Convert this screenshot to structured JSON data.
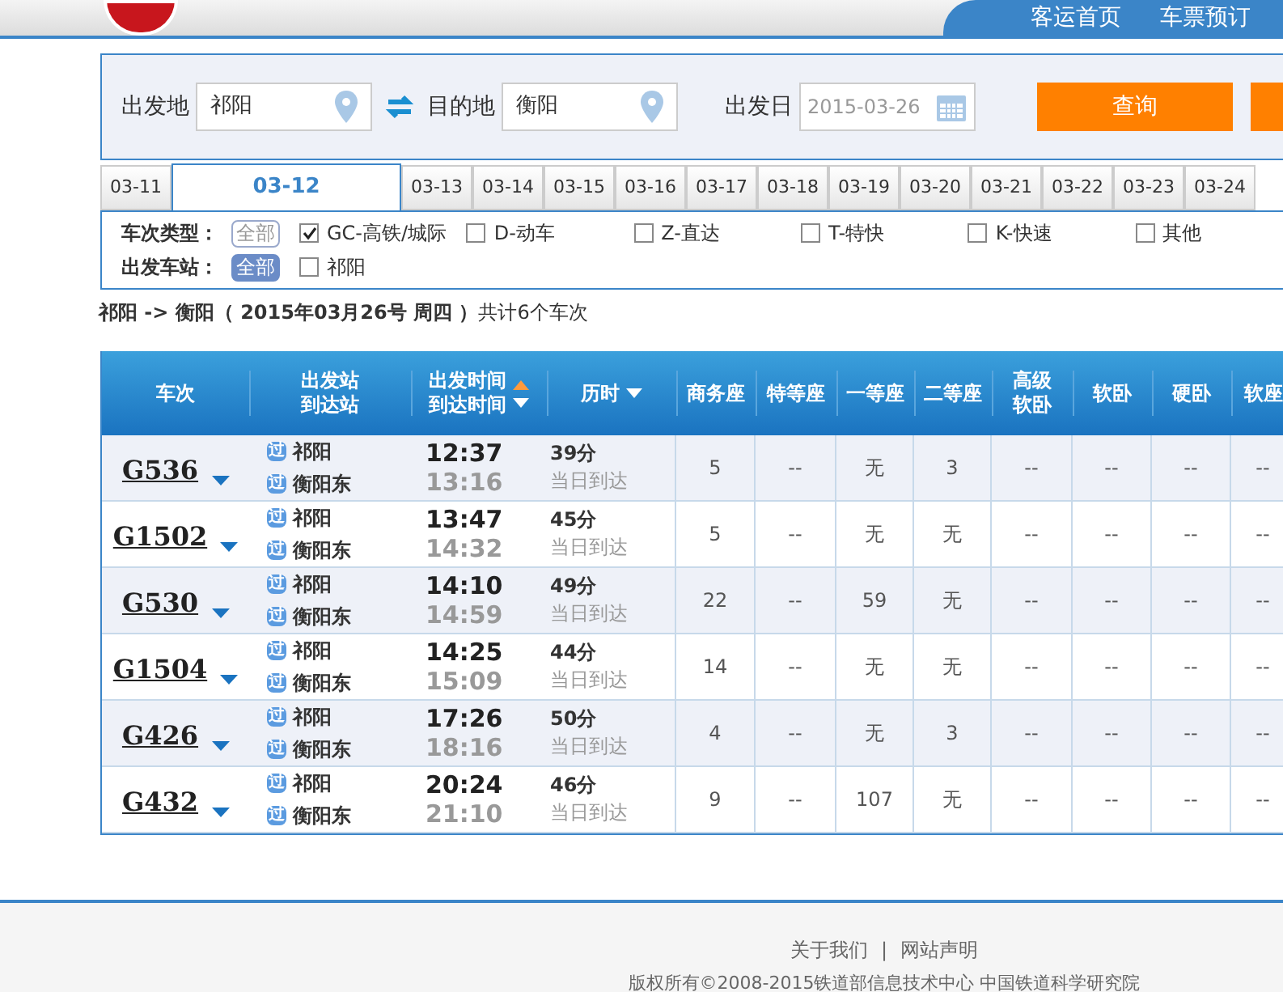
{
  "nav": {
    "links": [
      "客运首页",
      "车票预订"
    ]
  },
  "search": {
    "from_label": "出发地",
    "from_value": "祁阳",
    "to_label": "目的地",
    "to_value": "衡阳",
    "date_label": "出发日",
    "date_placeholder": "2015-03-26",
    "submit": "查询"
  },
  "date_tabs": [
    {
      "label": "03-11",
      "selected": false
    },
    {
      "label": "03-12",
      "selected": true
    },
    {
      "label": "03-13",
      "selected": false
    },
    {
      "label": "03-14",
      "selected": false
    },
    {
      "label": "03-15",
      "selected": false
    },
    {
      "label": "03-16",
      "selected": false
    },
    {
      "label": "03-17",
      "selected": false
    },
    {
      "label": "03-18",
      "selected": false
    },
    {
      "label": "03-19",
      "selected": false
    },
    {
      "label": "03-20",
      "selected": false
    },
    {
      "label": "03-21",
      "selected": false
    },
    {
      "label": "03-22",
      "selected": false
    },
    {
      "label": "03-23",
      "selected": false
    },
    {
      "label": "03-24",
      "selected": false
    }
  ],
  "filters": [
    {
      "label": "车次类型：",
      "all": {
        "label": "全部",
        "selected": false
      },
      "options": [
        {
          "label": "GC-高铁/城际",
          "checked": true
        },
        {
          "label": "D-动车",
          "checked": false
        },
        {
          "label": "Z-直达",
          "checked": false
        },
        {
          "label": "T-特快",
          "checked": false
        },
        {
          "label": "K-快速",
          "checked": false
        },
        {
          "label": "其他",
          "checked": false
        }
      ]
    },
    {
      "label": "出发车站：",
      "all": {
        "label": "全部",
        "selected": true
      },
      "options": [
        {
          "label": "祁阳",
          "checked": false
        }
      ]
    }
  ],
  "summary": {
    "route": "祁阳 -> 衡阳（ 2015年03月26号  周四 ）",
    "count": "共计6个车次"
  },
  "table": {
    "columns": [
      {
        "lines": [
          "车次"
        ],
        "kind": "plain"
      },
      {
        "lines": [
          "出发站",
          "到达站"
        ],
        "kind": "plain"
      },
      {
        "lines": [
          "出发时间",
          "到达时间"
        ],
        "kind": "sortboth"
      },
      {
        "lines": [
          "历时"
        ],
        "kind": "sortdown"
      },
      {
        "lines": [
          "商务座"
        ],
        "kind": "plain"
      },
      {
        "lines": [
          "特等座"
        ],
        "kind": "plain"
      },
      {
        "lines": [
          "一等座"
        ],
        "kind": "plain"
      },
      {
        "lines": [
          "二等座"
        ],
        "kind": "plain"
      },
      {
        "lines": [
          "高级",
          "软卧"
        ],
        "kind": "plain"
      },
      {
        "lines": [
          "软卧"
        ],
        "kind": "plain"
      },
      {
        "lines": [
          "硬卧"
        ],
        "kind": "plain"
      },
      {
        "lines": [
          "软座"
        ],
        "kind": "plain"
      }
    ],
    "rows": [
      {
        "train": "G536",
        "from": {
          "badge": "过",
          "name": "祁阳"
        },
        "to": {
          "badge": "过",
          "name": "衡阳东"
        },
        "depart": "12:37",
        "arrive": "13:16",
        "duration": "39分",
        "arrival_day": "当日到达",
        "seats": [
          "5",
          "--",
          "无",
          "3",
          "--",
          "--",
          "--",
          "--"
        ]
      },
      {
        "train": "G1502",
        "from": {
          "badge": "过",
          "name": "祁阳"
        },
        "to": {
          "badge": "过",
          "name": "衡阳东"
        },
        "depart": "13:47",
        "arrive": "14:32",
        "duration": "45分",
        "arrival_day": "当日到达",
        "seats": [
          "5",
          "--",
          "无",
          "无",
          "--",
          "--",
          "--",
          "--"
        ]
      },
      {
        "train": "G530",
        "from": {
          "badge": "过",
          "name": "祁阳"
        },
        "to": {
          "badge": "过",
          "name": "衡阳东"
        },
        "depart": "14:10",
        "arrive": "14:59",
        "duration": "49分",
        "arrival_day": "当日到达",
        "seats": [
          "22",
          "--",
          "59",
          "无",
          "--",
          "--",
          "--",
          "--"
        ]
      },
      {
        "train": "G1504",
        "from": {
          "badge": "过",
          "name": "祁阳"
        },
        "to": {
          "badge": "过",
          "name": "衡阳东"
        },
        "depart": "14:25",
        "arrive": "15:09",
        "duration": "44分",
        "arrival_day": "当日到达",
        "seats": [
          "14",
          "--",
          "无",
          "无",
          "--",
          "--",
          "--",
          "--"
        ]
      },
      {
        "train": "G426",
        "from": {
          "badge": "过",
          "name": "祁阳"
        },
        "to": {
          "badge": "过",
          "name": "衡阳东"
        },
        "depart": "17:26",
        "arrive": "18:16",
        "duration": "50分",
        "arrival_day": "当日到达",
        "seats": [
          "4",
          "--",
          "无",
          "3",
          "--",
          "--",
          "--",
          "--"
        ]
      },
      {
        "train": "G432",
        "from": {
          "badge": "过",
          "name": "祁阳"
        },
        "to": {
          "badge": "过",
          "name": "衡阳东"
        },
        "depart": "20:24",
        "arrive": "21:10",
        "duration": "46分",
        "arrival_day": "当日到达",
        "seats": [
          "9",
          "--",
          "107",
          "无",
          "--",
          "--",
          "--",
          "--"
        ]
      }
    ]
  },
  "footer": {
    "links": [
      "关于我们",
      "网站声明"
    ],
    "separator": "|",
    "copyright": "版权所有©2008-2015铁道部信息技术中心  中国铁道科学研究院"
  }
}
